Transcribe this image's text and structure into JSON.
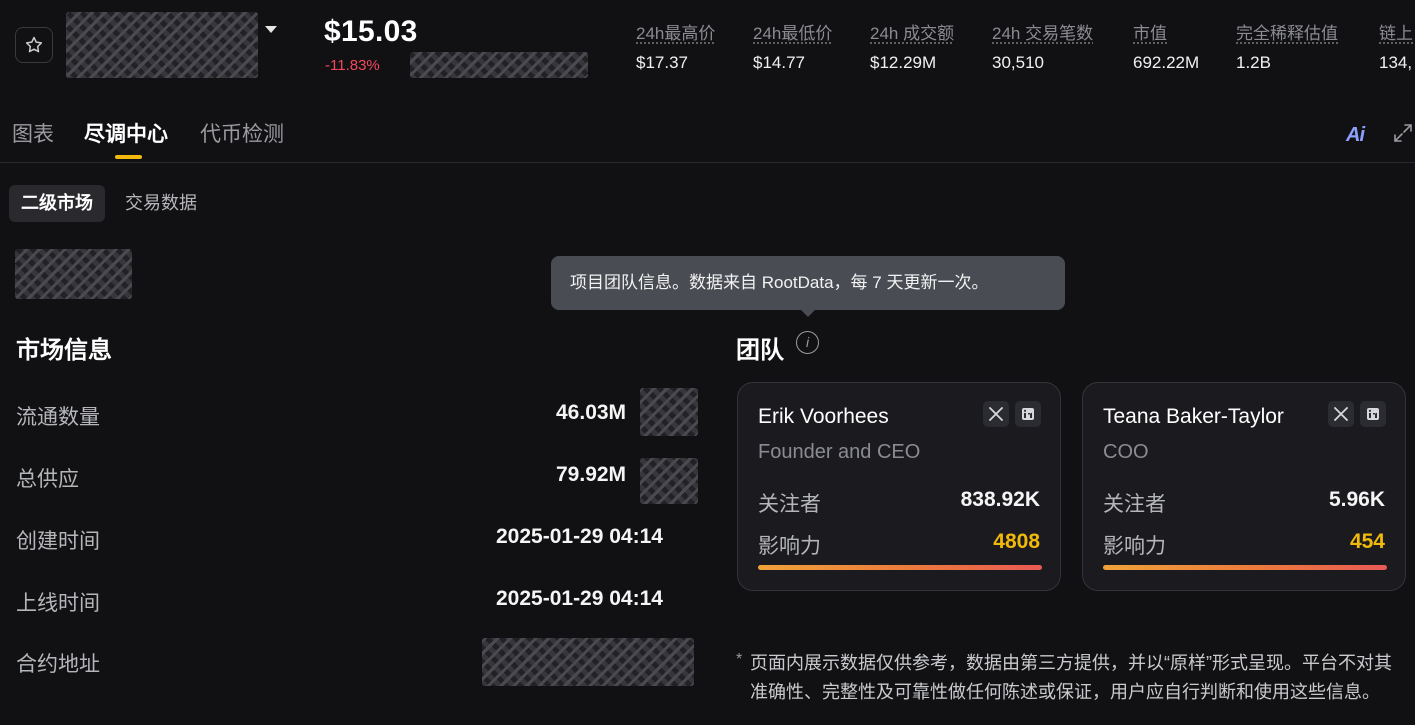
{
  "header": {
    "price": "$15.03",
    "change": "-11.83%",
    "stats": [
      {
        "label": "24h最高价",
        "value": "$17.37"
      },
      {
        "label": "24h最低价",
        "value": "$14.77"
      },
      {
        "label": "24h 成交额",
        "value": "$12.29M"
      },
      {
        "label": "24h 交易笔数",
        "value": "30,510"
      },
      {
        "label": "市值",
        "value": "692.22M"
      },
      {
        "label": "完全稀释估值",
        "value": "1.2B"
      },
      {
        "label": "链上",
        "value": "134,"
      }
    ]
  },
  "tabs": [
    "图表",
    "尽调中心",
    "代币检测"
  ],
  "ai_label": "Ai",
  "subtabs": [
    "二级市场",
    "交易数据"
  ],
  "market": {
    "title": "市场信息",
    "rows": [
      {
        "label": "流通数量",
        "value": "46.03M"
      },
      {
        "label": "总供应",
        "value": "79.92M"
      },
      {
        "label": "创建时间",
        "value": "2025-01-29 04:14"
      },
      {
        "label": "上线时间",
        "value": "2025-01-29 04:14"
      },
      {
        "label": "合约地址",
        "value": ""
      }
    ]
  },
  "tooltip": "项目团队信息。数据来自 RootData，每 7 天更新一次。",
  "team": {
    "title": "团队",
    "info_glyph": "i",
    "members": [
      {
        "name": "Erik Voorhees",
        "role": "Founder and CEO",
        "followers_label": "关注者",
        "followers": "838.92K",
        "influence_label": "影响力",
        "influence": "4808"
      },
      {
        "name": "Teana Baker-Taylor",
        "role": "COO",
        "followers_label": "关注者",
        "followers": "5.96K",
        "influence_label": "影响力",
        "influence": "454"
      }
    ]
  },
  "disclaimer_mark": "*",
  "disclaimer": "页面内展示数据仅供参考，数据由第三方提供，并以“原样”形式呈现。平台不对其准确性、完整性及可靠性做任何陈述或保证，用户应自行判断和使用这些信息。",
  "colors": {
    "accent": "#f0b90b",
    "negative": "#f6465d",
    "tooltip": "#4a4c54"
  }
}
